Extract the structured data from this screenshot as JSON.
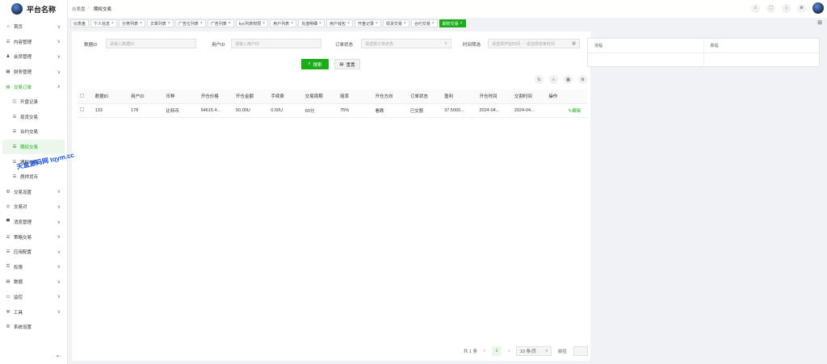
{
  "brand": {
    "title": "平台名称"
  },
  "breadcrumb": {
    "home": "仪表盘",
    "current": "期权交易"
  },
  "sidebar": {
    "items": [
      {
        "icon": "⌂",
        "label": "首页",
        "chevron": "∨"
      },
      {
        "icon": "☰",
        "label": "内容管理",
        "chevron": "∨"
      },
      {
        "icon": "♟",
        "label": "会员管理",
        "chevron": "∨"
      },
      {
        "icon": "▦",
        "label": "财务管理",
        "chevron": "∨"
      },
      {
        "icon": "▤",
        "label": "交易订单",
        "chevron": "∧",
        "open": true
      },
      {
        "icon": "◫",
        "label": "开盘记录",
        "sub": true
      },
      {
        "icon": "☰",
        "label": "现货交易",
        "sub": true
      },
      {
        "icon": "☰",
        "label": "合约交易",
        "sub": true
      },
      {
        "icon": "☰",
        "label": "期权交易",
        "sub": true,
        "active": true
      },
      {
        "icon": "☰",
        "label": "理财申购",
        "sub": true
      },
      {
        "icon": "☰",
        "label": "质押货币",
        "sub": true
      },
      {
        "icon": "⚙",
        "label": "交易设置",
        "chevron": "∨"
      },
      {
        "icon": "◎",
        "label": "交易对",
        "chevron": "∨"
      },
      {
        "icon": "▀",
        "label": "消息管理",
        "chevron": "∨"
      },
      {
        "icon": "☰",
        "label": "策略交易",
        "chevron": "∨"
      },
      {
        "icon": "☰",
        "label": "应用配置",
        "chevron": "∨"
      },
      {
        "icon": "⚿",
        "label": "权限",
        "chevron": "∨"
      },
      {
        "icon": "▤",
        "label": "数据",
        "chevron": "∨"
      },
      {
        "icon": "▭",
        "label": "监控",
        "chevron": "∨"
      },
      {
        "icon": "⚒",
        "label": "工具",
        "chevron": "∨"
      },
      {
        "icon": "⚙",
        "label": "系统设置"
      }
    ]
  },
  "tabs": [
    {
      "label": "仪表盘",
      "closable": false
    },
    {
      "label": "个人信息",
      "closable": true
    },
    {
      "label": "分类列表",
      "closable": true
    },
    {
      "label": "文章列表",
      "closable": true
    },
    {
      "label": "广告位列表",
      "closable": true
    },
    {
      "label": "广告列表",
      "closable": true
    },
    {
      "label": "kyc列表权限",
      "closable": true
    },
    {
      "label": "用户列表",
      "closable": true
    },
    {
      "label": "充值明细",
      "closable": true
    },
    {
      "label": "用户钱包",
      "closable": true
    },
    {
      "label": "开盘记录",
      "closable": true
    },
    {
      "label": "现货交易",
      "closable": true
    },
    {
      "label": "合约交易",
      "closable": true
    },
    {
      "label": "期权交易",
      "closable": true,
      "active": true
    }
  ],
  "filters": {
    "data_id_label": "数据ID",
    "data_id_placeholder": "请输入数据ID",
    "user_id_label": "用户ID",
    "user_id_placeholder": "请输入用户ID",
    "status_label": "订单状态",
    "status_placeholder": "请选择订单状态",
    "time_label": "时间筛选",
    "time_start_placeholder": "请选择开始时间",
    "time_sep": "-",
    "time_end_placeholder": "请选择结束时间",
    "search_label": "搜索",
    "reset_label": "重置"
  },
  "side_panel": {
    "col1": "涨幅",
    "col2": "跌幅"
  },
  "table": {
    "headers": [
      "数据ID",
      "用户ID",
      "币种",
      "开仓价格",
      "开仓金额",
      "手续费",
      "交易周期",
      "赔率",
      "开仓方向",
      "订单状态",
      "盈利",
      "开仓时间",
      "交割时间",
      "操作"
    ],
    "rows": [
      [
        "133",
        "178",
        "比特币",
        "64615.4...",
        "50.00U",
        "0.50U",
        "60分",
        "75%",
        "看跌",
        "已交割",
        "37.5000...",
        "2024-04...",
        "2024-04...",
        "编辑"
      ]
    ]
  },
  "pagination": {
    "total": "共 1 条",
    "prev": "‹",
    "page": "1",
    "next": "›",
    "size": "10 条/页",
    "goto": "前往"
  },
  "watermark": "天盒源码网 tqym.cc",
  "colors": {
    "accent": "#1aad19"
  }
}
